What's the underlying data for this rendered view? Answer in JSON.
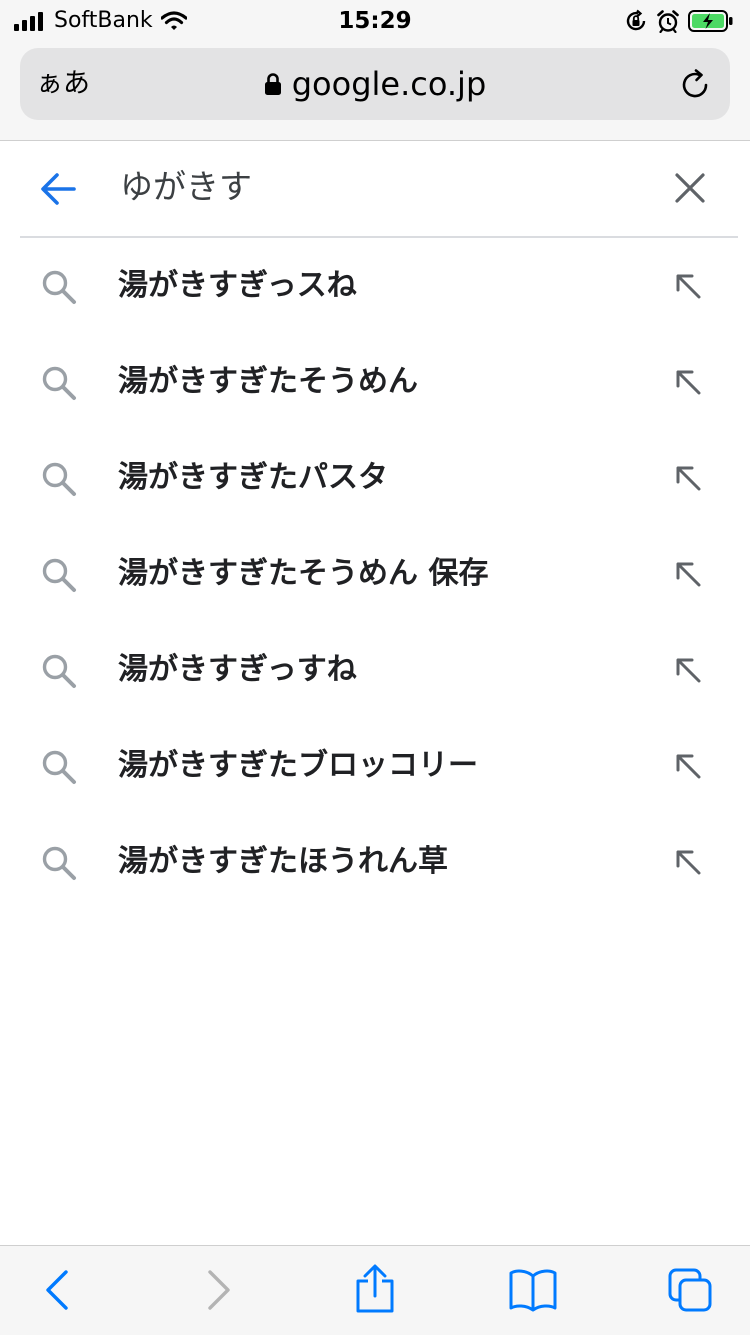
{
  "status_bar": {
    "carrier": "SoftBank",
    "time": "15:29",
    "icons": [
      "signal-icon",
      "wifi-icon",
      "orientation-lock-icon",
      "alarm-icon",
      "battery-charging-icon"
    ],
    "battery_color": "#4cd964"
  },
  "address_bar": {
    "text_size_label": "ぁあ",
    "url": "google.co.jp",
    "icons": [
      "lock-icon",
      "reload-icon"
    ]
  },
  "search": {
    "query": "ゆがきす",
    "icons": [
      "back-arrow-icon",
      "clear-icon"
    ],
    "accent_color": "#1a73e8"
  },
  "suggestions": [
    "湯がきすぎっスね",
    "湯がきすぎたそうめん",
    "湯がきすぎたパスタ",
    "湯がきすぎたそうめん 保存",
    "湯がきすぎっすね",
    "湯がきすぎたブロッコリー",
    "湯がきすぎたほうれん草"
  ],
  "toolbar": {
    "icons": [
      "back-icon",
      "forward-icon",
      "share-icon",
      "bookmarks-icon",
      "tabs-icon"
    ],
    "active_color": "#007aff",
    "disabled_color": "#b4b4b4"
  }
}
